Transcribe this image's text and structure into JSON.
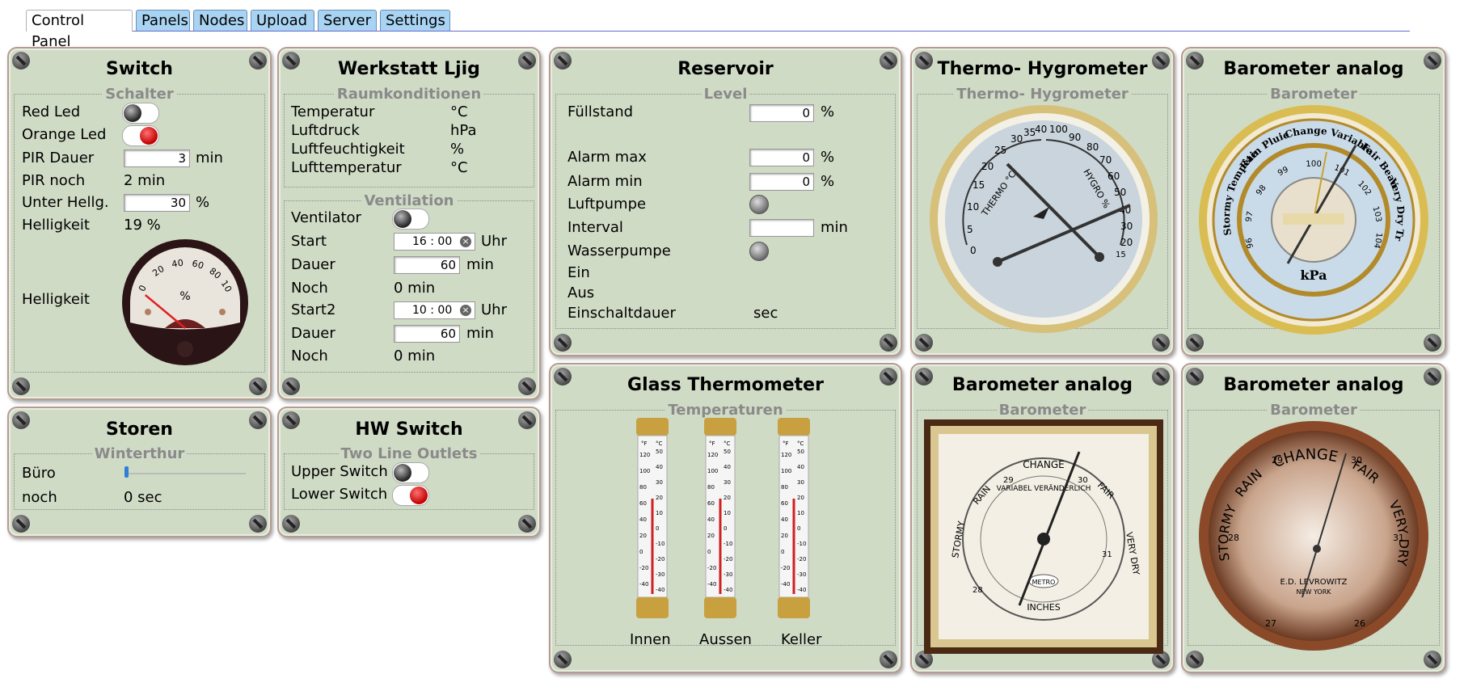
{
  "tabs": [
    "Control Panel",
    "Panels",
    "Nodes",
    "Upload",
    "Server",
    "Settings"
  ],
  "switch_panel": {
    "title": "Switch",
    "legend": "Schalter",
    "red_led": "Red Led",
    "orange_led": "Orange Led",
    "pir_dauer": "PIR Dauer",
    "pir_dauer_value": "3",
    "pir_dauer_unit": "min",
    "pir_noch": "PIR noch",
    "pir_noch_value": "2 min",
    "unter_hellg": "Unter Hellg.",
    "unter_hellg_value": "30",
    "unter_hellg_unit": "%",
    "helligkeit": "Helligkeit",
    "helligkeit_value": "19 %",
    "helligkeit_gauge_label": "Helligkeit",
    "gauge": {
      "ticks": [
        "0",
        "20",
        "40",
        "60",
        "80",
        "100"
      ],
      "unit": "%",
      "value": 19
    }
  },
  "werkstatt_panel": {
    "title": "Werkstatt Ljig",
    "legend1": "Raumkonditionen",
    "rows": [
      {
        "label": "Temperatur",
        "unit": "°C"
      },
      {
        "label": "Luftdruck",
        "unit": "hPa"
      },
      {
        "label": "Luftfeuchtigkeit",
        "unit": "%"
      },
      {
        "label": "Lufttemperatur",
        "unit": "°C"
      }
    ],
    "legend2": "Ventilation",
    "ventilator": "Ventilator",
    "start": "Start",
    "start_value": "16 : 00",
    "start_unit": "Uhr",
    "dauer": "Dauer",
    "dauer_value": "60",
    "dauer_unit": "min",
    "noch": "Noch",
    "noch_value": "0 min",
    "start2": "Start2",
    "start2_value": "10 : 00",
    "start2_unit": "Uhr",
    "dauer2": "Dauer",
    "dauer2_value": "60",
    "dauer2_unit": "min",
    "noch2": "Noch",
    "noch2_value": "0 min"
  },
  "reservoir_panel": {
    "title": "Reservoir",
    "legend": "Level",
    "fuellstand": "Füllstand",
    "fuellstand_value": "0",
    "fuellstand_unit": "%",
    "alarm_max": "Alarm max",
    "alarm_max_value": "0",
    "alarm_max_unit": "%",
    "alarm_min": "Alarm min",
    "alarm_min_value": "0",
    "alarm_min_unit": "%",
    "luftpumpe": "Luftpumpe",
    "interval": "Interval",
    "interval_value": "",
    "interval_unit": "min",
    "wasserpumpe": "Wasserpumpe",
    "ein": "Ein",
    "aus": "Aus",
    "einschaltdauer": "Einschaltdauer",
    "einschaltdauer_unit": "sec"
  },
  "thermo_panel": {
    "title": "Thermo- Hygrometer",
    "legend": "Thermo- Hygrometer",
    "left_scale": [
      "0",
      "5",
      "10",
      "15",
      "20",
      "25",
      "30",
      "35",
      "40"
    ],
    "right_scale": [
      "100",
      "90",
      "80",
      "70",
      "60",
      "50",
      "40",
      "30",
      "20",
      "15"
    ],
    "left_label": "THERMO °C",
    "right_label": "HYGRO %"
  },
  "baro1_panel": {
    "title": "Barometer analog",
    "legend": "Barometer",
    "words": [
      "Stormy Tempête",
      "Rain Pluie",
      "Change Variable",
      "Fair Beau",
      "Very Dry Trés Sec"
    ],
    "unit": "kPa",
    "ticks": [
      "96",
      "97",
      "98",
      "99",
      "100",
      "101",
      "102",
      "103",
      "104"
    ]
  },
  "storen_panel": {
    "title": "Storen",
    "legend": "Winterthur",
    "buero": "Büro",
    "noch": "noch",
    "noch_value": "0 sec"
  },
  "hw_panel": {
    "title": "HW Switch",
    "legend": "Two Line Outlets",
    "upper": "Upper Switch",
    "lower": "Lower Switch"
  },
  "glass_panel": {
    "title": "Glass Thermometer",
    "legend": "Temperaturen",
    "labels": [
      "Innen",
      "Aussen",
      "Keller"
    ],
    "f_scale": [
      "120",
      "100",
      "80",
      "60",
      "40",
      "20",
      "0",
      "-20",
      "-40"
    ],
    "c_scale": [
      "50",
      "40",
      "30",
      "20",
      "10",
      "0",
      "-10",
      "-20",
      "-30",
      "-40"
    ],
    "unit_f": "°F",
    "unit_c": "°C"
  },
  "baro2_panel": {
    "title": "Barometer analog",
    "legend": "Barometer",
    "words": [
      "STORMY",
      "RAIN",
      "CHANGE",
      "FAIR",
      "VERY DRY"
    ],
    "center": "VARIABEL VERÄNDERLICH",
    "brand": "METRO",
    "unit": "INCHES",
    "ticks": [
      "28",
      "29",
      "30",
      "31"
    ]
  },
  "baro3_panel": {
    "title": "Barometer analog",
    "legend": "Barometer",
    "words": [
      "STORMY",
      "RAIN",
      "CHANGE",
      "FAIR",
      "VERY DRY"
    ],
    "maker": "E.D. LEVROWITZ",
    "city": "NEW YORK",
    "ticks": [
      "28",
      "29",
      "30",
      "31",
      "27",
      "26"
    ]
  }
}
